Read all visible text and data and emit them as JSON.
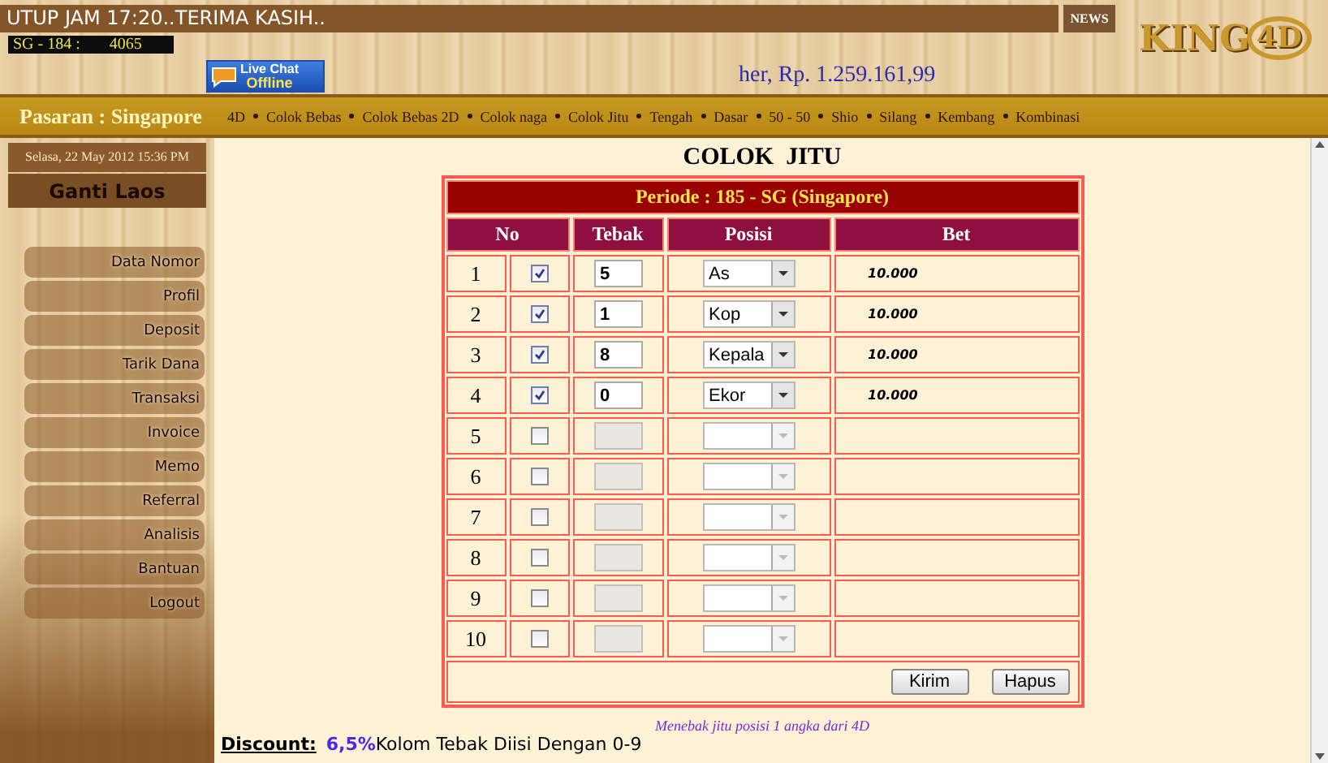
{
  "ticker": {
    "text": "UTUP JAM 17:20..TERIMA KASIH.."
  },
  "news_button": "NEWS",
  "result": {
    "label": "SG - 184 :",
    "number": "4065"
  },
  "live_chat": {
    "title": "Live Chat",
    "status": "Offline"
  },
  "balance": "her, Rp. 1.259.161,99",
  "logo": {
    "text": "KING",
    "accent": "4D"
  },
  "market": "Pasaran : Singapore",
  "nav": [
    "4D",
    "Colok Bebas",
    "Colok Bebas 2D",
    "Colok naga",
    "Colok Jitu",
    "Tengah",
    "Dasar",
    "50 - 50",
    "Shio",
    "Silang",
    "Kembang",
    "Kombinasi"
  ],
  "sidebar": {
    "date": "Selasa, 22 May 2012 15:36 PM",
    "switch": "Ganti Laos",
    "items": [
      "Data Nomor",
      "Profil",
      "Deposit",
      "Tarik Dana",
      "Transaksi",
      "Invoice",
      "Memo",
      "Referral",
      "Analisis",
      "Bantuan",
      "Logout"
    ]
  },
  "form": {
    "title": "COLOK  JITU",
    "period": "Periode : 185 - SG (Singapore)",
    "columns": [
      "No",
      "Tebak",
      "Posisi",
      "Bet"
    ],
    "rows": [
      {
        "no": "1",
        "checked": true,
        "guess": "5",
        "position": "As",
        "bet": "10.000"
      },
      {
        "no": "2",
        "checked": true,
        "guess": "1",
        "position": "Kop",
        "bet": "10.000"
      },
      {
        "no": "3",
        "checked": true,
        "guess": "8",
        "position": "Kepala",
        "bet": "10.000"
      },
      {
        "no": "4",
        "checked": true,
        "guess": "0",
        "position": "Ekor",
        "bet": "10.000"
      },
      {
        "no": "5",
        "checked": false
      },
      {
        "no": "6",
        "checked": false
      },
      {
        "no": "7",
        "checked": false
      },
      {
        "no": "8",
        "checked": false
      },
      {
        "no": "9",
        "checked": false
      },
      {
        "no": "10",
        "checked": false
      }
    ],
    "buttons": [
      "Kirim",
      "Hapus"
    ]
  },
  "hint": "Menebak jitu posisi 1 angka dari 4D",
  "footer": {
    "label": "Discount:",
    "discount": "6,5%",
    "note": "Kolom Tebak Diisi Dengan 0-9"
  }
}
